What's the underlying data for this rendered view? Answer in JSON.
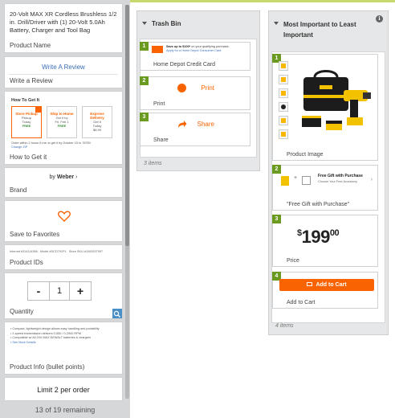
{
  "app": {
    "remaining_text": "13 of 19 remaining"
  },
  "available_cards": [
    {
      "caption": "Product Name",
      "text": "20-Volt MAX XR Cordless Brushless 1/2 in. Drill/Driver with (1) 20-Volt 5.0Ah Battery, Charger and Tool Bag"
    },
    {
      "caption": "Write a Review",
      "link": "Write A Review"
    },
    {
      "caption": "How to Get it"
    },
    {
      "caption": "Brand",
      "prefix": "by",
      "brand": "Weber",
      "chevron": "›"
    },
    {
      "caption": "Save to Favorites"
    },
    {
      "caption": "Product IDs"
    },
    {
      "caption": "Quantity",
      "minus": "-",
      "value": "1",
      "plus": "+"
    },
    {
      "caption": "Product Info (bullet points)"
    },
    {
      "caption": "",
      "text": "Limit 2 per order"
    }
  ],
  "trash_bin": {
    "title": "Trash Bin",
    "count_text": "3 items",
    "items": [
      {
        "num": "1",
        "caption": "Home Depot Credit Card"
      },
      {
        "num": "2",
        "caption": "Print",
        "button": "Print"
      },
      {
        "num": "3",
        "caption": "Share",
        "button": "Share"
      }
    ]
  },
  "ranking": {
    "title": "Most Important to Least Important",
    "info_icon": "i",
    "count_text": "4 items",
    "items": [
      {
        "num": "1",
        "caption": "Product Image"
      },
      {
        "num": "2",
        "caption": "\"Free Gift with Purchase\"",
        "gift_title": "Free Gift with Purchase",
        "plus": "+",
        "chevron": "›"
      },
      {
        "num": "3",
        "caption": "Price",
        "currency": "$",
        "dollars": "199",
        "cents": "00"
      },
      {
        "num": "4",
        "caption": "Add to Cart",
        "button": "Add to Cart"
      }
    ]
  },
  "colors": {
    "accent": "#f96302",
    "badge_green": "#6a9a1f",
    "link_blue": "#3b6fb6",
    "top_stripe": "#c8d86e"
  },
  "icons": [
    "heart-icon",
    "print-icon",
    "share-icon",
    "chevron-down-icon",
    "info-icon",
    "search-icon",
    "cart-icon",
    "credit-card-icon",
    "gift-icon",
    "drill-image"
  ]
}
